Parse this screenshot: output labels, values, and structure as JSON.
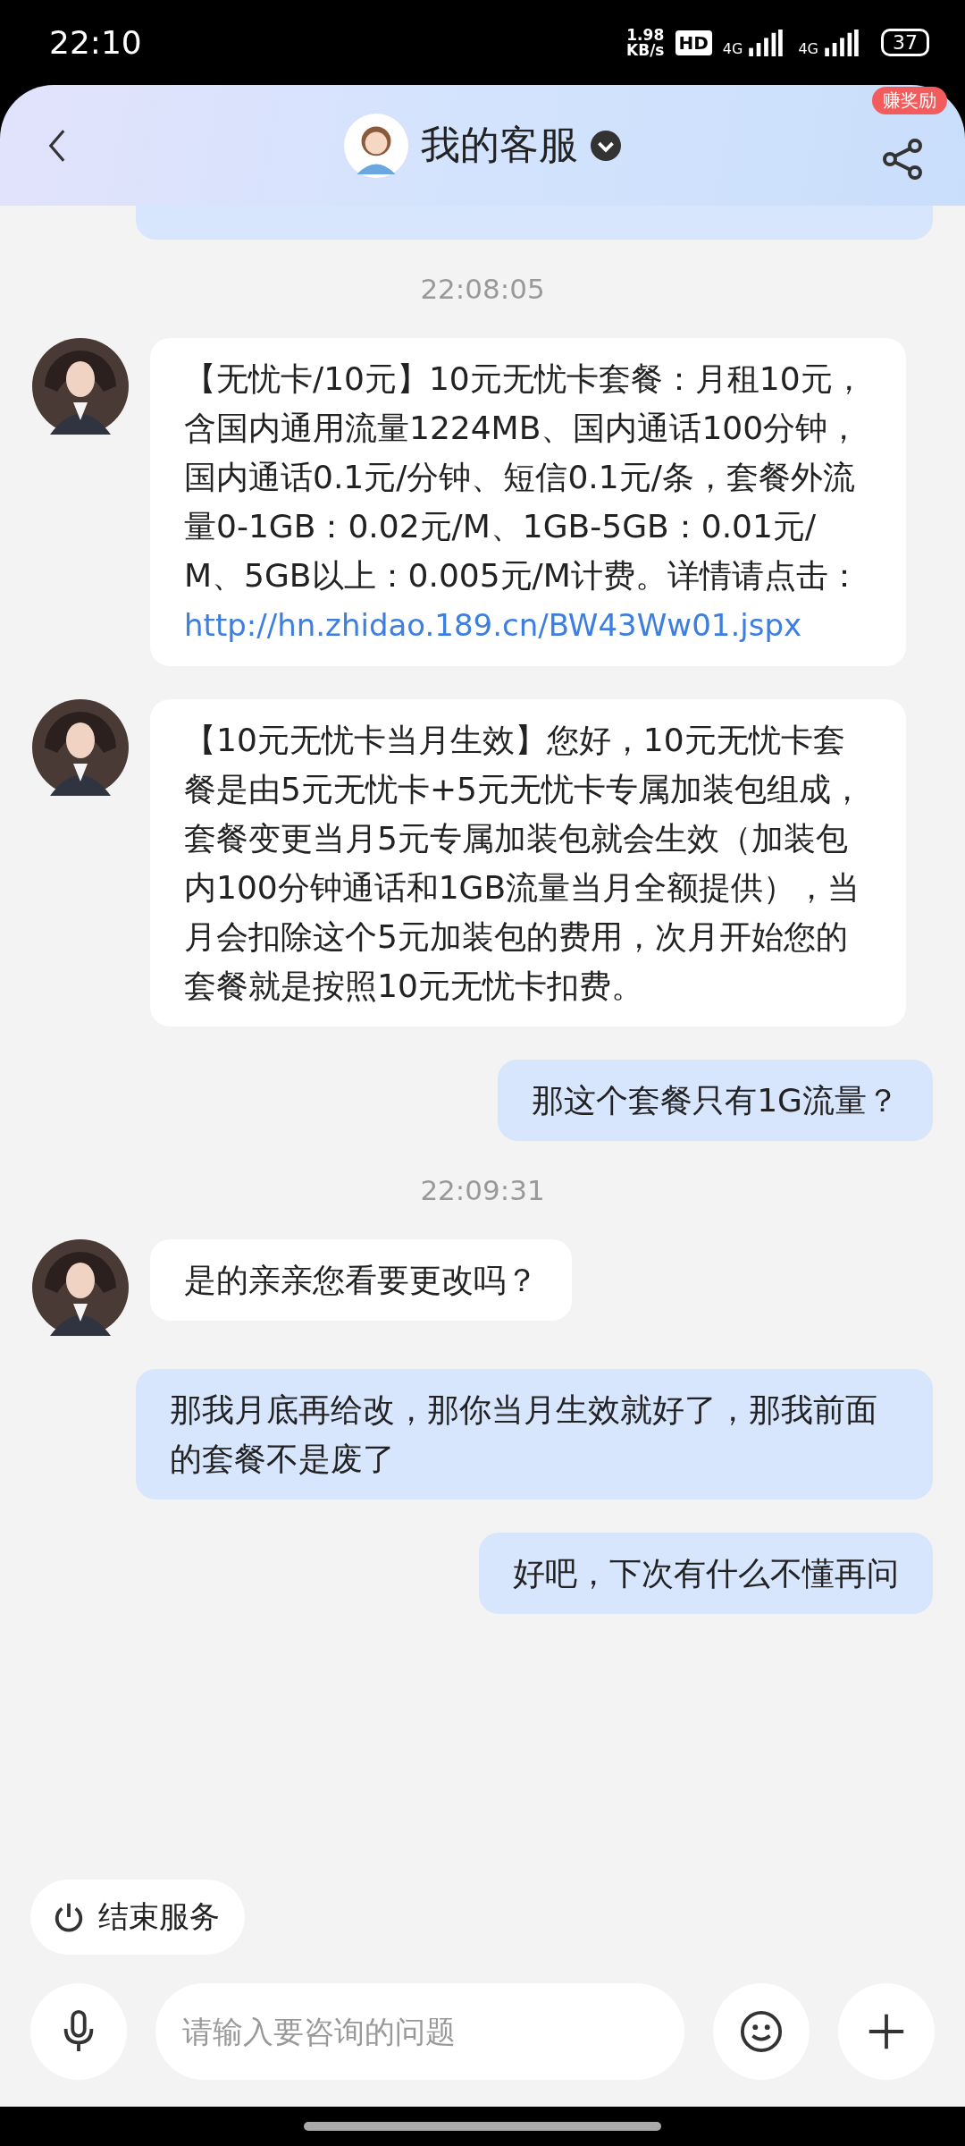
{
  "status_bar": {
    "time": "22:10",
    "speed_value": "1.98",
    "speed_unit": "KB/s",
    "hd_badge": "HD",
    "signals": [
      "4G",
      "4G"
    ],
    "battery": "37"
  },
  "header": {
    "title": "我的客服",
    "reward_badge": "赚奖励"
  },
  "messages": [
    {
      "kind": "cut_off"
    },
    {
      "kind": "time",
      "text": "22:08:05"
    },
    {
      "kind": "agent",
      "text": "【无忧卡/10元】10元无忧卡套餐：月租10元，含国内通用流量1224MB、国内通话100分钟，国内通话0.1元/分钟、短信0.1元/条，套餐外流量0-1GB：0.02元/M、1GB-5GB：0.01元/M、5GB以上：0.005元/M计费。详情请点击：",
      "link": "http://hn.zhidao.189.cn/BW43Ww01.jspx"
    },
    {
      "kind": "agent",
      "text": "【10元无忧卡当月生效】您好，10元无忧卡套餐是由5元无忧卡+5元无忧卡专属加装包组成，套餐变更当月5元专属加装包就会生效（加装包内100分钟通话和1GB流量当月全额提供），当月会扣除这个5元加装包的费用，次月开始您的套餐就是按照10元无忧卡扣费。"
    },
    {
      "kind": "user",
      "text": "那这个套餐只有1G流量？"
    },
    {
      "kind": "time",
      "text": "22:09:31"
    },
    {
      "kind": "agent",
      "text": "是的亲亲您看要更改吗？"
    },
    {
      "kind": "user",
      "text": "那我月底再给改，那你当月生效就好了，那我前面的套餐不是废了"
    },
    {
      "kind": "user",
      "text": "好吧，下次有什么不懂再问"
    }
  ],
  "end_service": "结束服务",
  "input": {
    "placeholder": "请输入要咨询的问题"
  }
}
